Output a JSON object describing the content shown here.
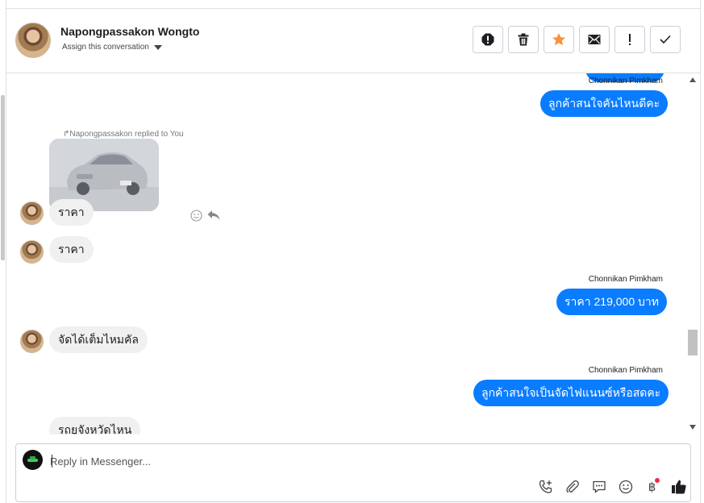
{
  "header": {
    "contact_name": "Napongpassakon Wongto",
    "assign_label": "Assign this conversation"
  },
  "actions": [
    {
      "name": "report-spam",
      "icon": "alert-octagon-icon"
    },
    {
      "name": "delete",
      "icon": "trash-icon"
    },
    {
      "name": "star",
      "icon": "star-icon",
      "color": "#f7923b"
    },
    {
      "name": "mark-unread",
      "icon": "envelope-icon"
    },
    {
      "name": "follow-up",
      "icon": "exclamation-icon"
    },
    {
      "name": "mark-done",
      "icon": "check-icon"
    }
  ],
  "messages": {
    "m1": {
      "sender": "Chonnikan Pimkham",
      "text": "ลูกค้าสนใจคันไหนดีคะ"
    },
    "reply_note": "Napongpassakon replied to You",
    "m2": {
      "text": "ราคา"
    },
    "m3": {
      "text": "ราคา"
    },
    "m4": {
      "sender": "Chonnikan Pimkham",
      "text": "ราคา 219,000 บาท"
    },
    "m5": {
      "text": "จัดได้เต็มไหมคัล"
    },
    "m6": {
      "sender": "Chonnikan Pimkham",
      "text": "ลูกค้าสนใจเป็นจัดไฟแนนซ์หรือสดคะ"
    },
    "m7": {
      "text": "รถยูจังหวัดไหน"
    }
  },
  "composer": {
    "placeholder": "Reply in Messenger...",
    "tools": [
      "phone-plus-icon",
      "paperclip-icon",
      "saved-reply-icon",
      "emoji-icon",
      "baht-icon",
      "like-icon"
    ],
    "baht_symbol": "฿"
  },
  "colors": {
    "outgoing_bubble": "#0a7cff",
    "incoming_bubble": "#f0f0f0",
    "notification_dot": "#f02849"
  }
}
